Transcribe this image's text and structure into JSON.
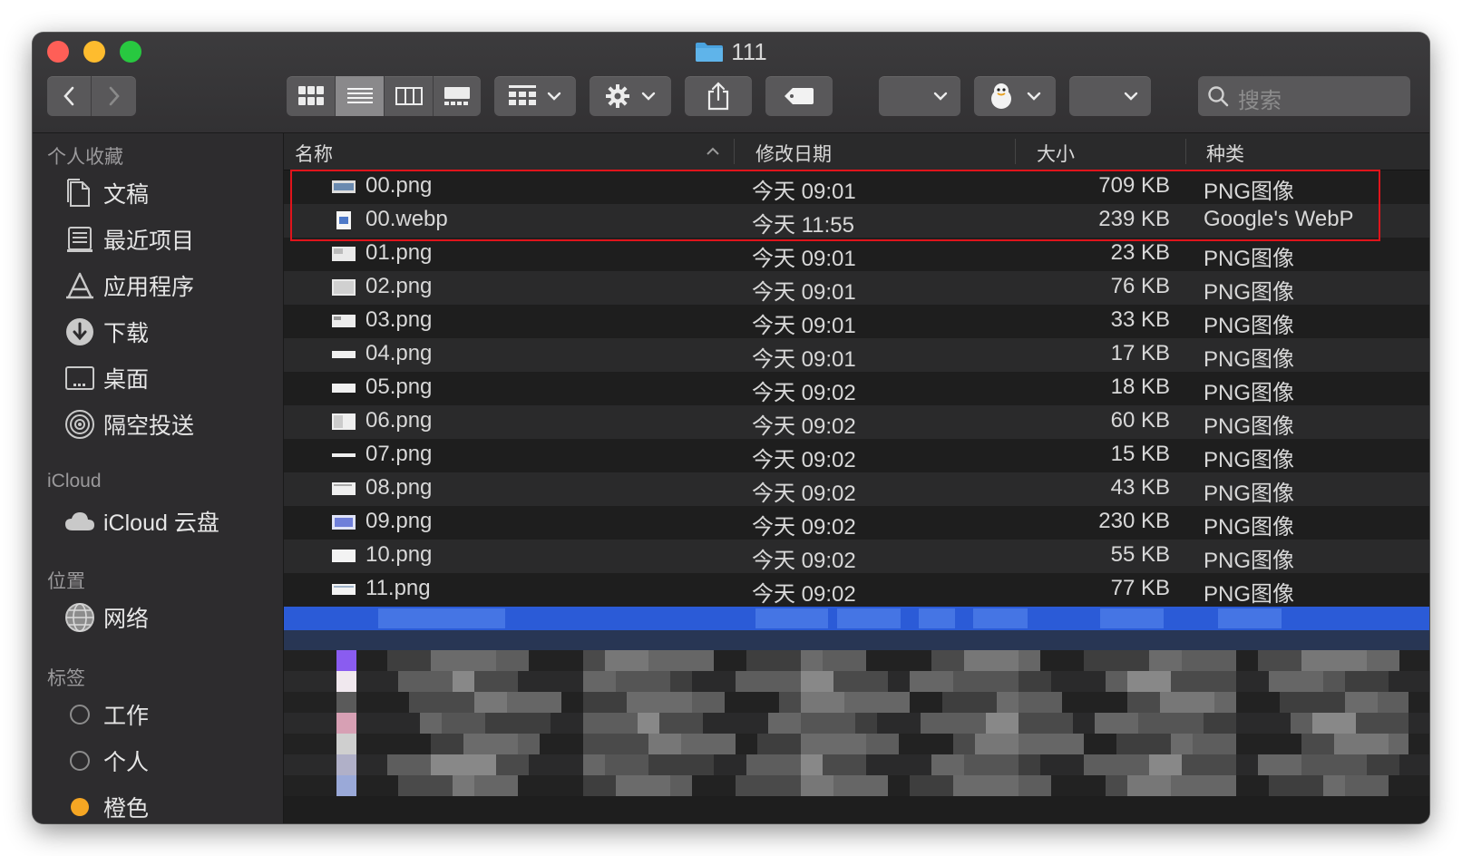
{
  "window": {
    "title": "111"
  },
  "toolbar": {
    "search_placeholder": "搜索"
  },
  "sidebar": {
    "favorites_heading": "个人收藏",
    "favorites": [
      {
        "label": "文稿",
        "icon": "document-icon"
      },
      {
        "label": "最近项目",
        "icon": "recents-icon"
      },
      {
        "label": "应用程序",
        "icon": "applications-icon"
      },
      {
        "label": "下载",
        "icon": "downloads-icon"
      },
      {
        "label": "桌面",
        "icon": "desktop-icon"
      },
      {
        "label": "隔空投送",
        "icon": "airdrop-icon"
      }
    ],
    "icloud_heading": "iCloud",
    "icloud": [
      {
        "label": "iCloud 云盘",
        "icon": "cloud-icon"
      }
    ],
    "locations_heading": "位置",
    "locations": [
      {
        "label": "网络",
        "icon": "network-icon"
      }
    ],
    "tags_heading": "标签",
    "tags": [
      {
        "label": "工作",
        "color": "#8c8c8c"
      },
      {
        "label": "个人",
        "color": "#8c8c8c"
      },
      {
        "label": "橙色",
        "color": "#f5a623"
      }
    ]
  },
  "columns": {
    "name": "名称",
    "date": "修改日期",
    "size": "大小",
    "kind": "种类"
  },
  "files": [
    {
      "name": "00.png",
      "date": "今天 09:01",
      "size": "709 KB",
      "kind": "PNG图像"
    },
    {
      "name": "00.webp",
      "date": "今天 11:55",
      "size": "239 KB",
      "kind": "Google's WebP"
    },
    {
      "name": "01.png",
      "date": "今天 09:01",
      "size": "23 KB",
      "kind": "PNG图像"
    },
    {
      "name": "02.png",
      "date": "今天 09:01",
      "size": "76 KB",
      "kind": "PNG图像"
    },
    {
      "name": "03.png",
      "date": "今天 09:01",
      "size": "33 KB",
      "kind": "PNG图像"
    },
    {
      "name": "04.png",
      "date": "今天 09:01",
      "size": "17 KB",
      "kind": "PNG图像"
    },
    {
      "name": "05.png",
      "date": "今天 09:02",
      "size": "18 KB",
      "kind": "PNG图像"
    },
    {
      "name": "06.png",
      "date": "今天 09:02",
      "size": "60 KB",
      "kind": "PNG图像"
    },
    {
      "name": "07.png",
      "date": "今天 09:02",
      "size": "15 KB",
      "kind": "PNG图像"
    },
    {
      "name": "08.png",
      "date": "今天 09:02",
      "size": "43 KB",
      "kind": "PNG图像"
    },
    {
      "name": "09.png",
      "date": "今天 09:02",
      "size": "230 KB",
      "kind": "PNG图像"
    },
    {
      "name": "10.png",
      "date": "今天 09:02",
      "size": "55 KB",
      "kind": "PNG图像"
    },
    {
      "name": "11.png",
      "date": "今天 09:02",
      "size": "77 KB",
      "kind": "PNG图像"
    }
  ],
  "colors": {
    "selection": "#2b5bd7",
    "annotation": "#e0141b"
  }
}
